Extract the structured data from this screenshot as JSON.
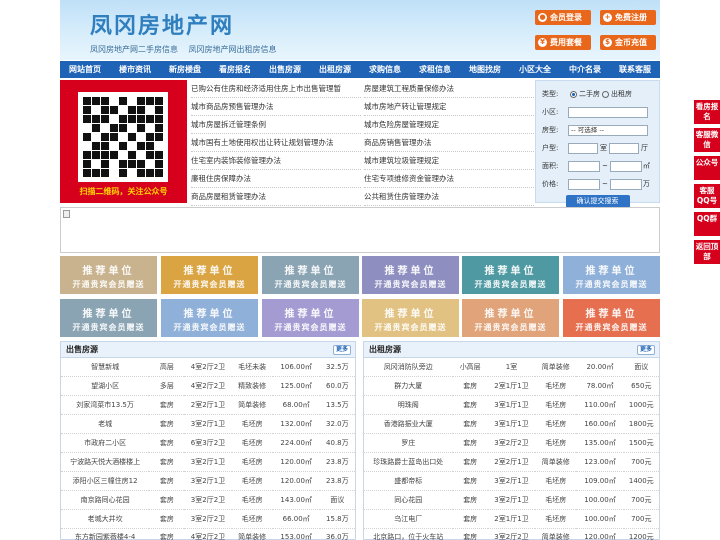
{
  "header": {
    "logo": "凤冈房地产网",
    "slogans": [
      "凤冈房地产网二手房信息",
      "凤冈房地产网出租房信息"
    ],
    "buttons": [
      "会员登录",
      "免费注册",
      "费用套餐",
      "金币充值"
    ]
  },
  "nav": [
    "网站首页",
    "楼市资讯",
    "新房楼盘",
    "看房报名",
    "出售房源",
    "出租房源",
    "求购信息",
    "求租信息",
    "地图找房",
    "小区大全",
    "中介名录",
    "联系客服"
  ],
  "qr": {
    "caption": "扫描二维码，关注公众号"
  },
  "links_left": [
    "已购公有住房和经济适用住房上市出售管理暂",
    "城市商品房预售管理办法",
    "城市房屋拆迁管理条例",
    "城市国有土地使用权出让转让规划管理办法",
    "住宅室内装饰装修管理办法",
    "廉租住房保障办法",
    "商品房屋租赁管理办法"
  ],
  "links_right": [
    "房屋建筑工程质量保修办法",
    "城市房地产转让管理规定",
    "城市危险房屋管理规定",
    "商品房销售管理办法",
    "城市建筑垃圾管理规定",
    "住宅专项维修资金管理办法",
    "公共租赁住房管理办法"
  ],
  "search": {
    "type_label": "类型:",
    "type_opt1": "二手房",
    "type_opt2": "出租房",
    "area_label": "小区:",
    "house_label": "房型:",
    "house_select": "-- 可选择 --",
    "layout_label": "户型:",
    "room_unit": "室",
    "hall_unit": "厅",
    "size_label": "面积:",
    "size_unit": "㎡",
    "price_label": "价格:",
    "price_unit": "万",
    "button": "确认提交搜索"
  },
  "ads": {
    "line1": "推荐单位",
    "line2": "开通贵宾会员赠送",
    "colors": [
      "#c9b38e",
      "#d9a441",
      "#8aa4b3",
      "#8e8fc0",
      "#4f9aa2",
      "#8fb0d8",
      "#8aa4b3",
      "#8fb0d8",
      "#a59bd3",
      "#e2c282",
      "#e0a37a",
      "#e66f4f"
    ]
  },
  "sale": {
    "title": "出售房源",
    "more": "更多",
    "rows": [
      [
        "智慧新城",
        "高层",
        "4室2厅2卫",
        "毛坯未装",
        "106.00㎡",
        "32.5万"
      ],
      [
        "望湖小区",
        "多层",
        "4室2厅2卫",
        "精致装修",
        "125.00㎡",
        "60.0万"
      ],
      [
        "刘家湾菜市13.5万",
        "套房",
        "2室2厅1卫",
        "简单装修",
        "68.00㎡",
        "13.5万"
      ],
      [
        "老城",
        "套房",
        "3室2厅1卫",
        "毛坯房",
        "132.00㎡",
        "32.0万"
      ],
      [
        "市政府二小区",
        "套房",
        "6室3厅2卫",
        "毛坯房",
        "224.00㎡",
        "40.8万"
      ],
      [
        "宁波路天悦大酒楼楼上",
        "套房",
        "3室2厅1卫",
        "毛坯房",
        "120.00㎡",
        "23.8万"
      ],
      [
        "添阳小区三幢住房12",
        "套房",
        "3室2厅1卫",
        "毛坯房",
        "120.00㎡",
        "23.8万"
      ],
      [
        "南京路同心花园",
        "套房",
        "3室2厅2卫",
        "毛坯房",
        "143.00㎡",
        "面议"
      ],
      [
        "老城大井坎",
        "套房",
        "3室2厅2卫",
        "毛坯房",
        "66.00㎡",
        "15.8万"
      ],
      [
        "东方新园紫薇楼4-4",
        "套房",
        "4室2厅2卫",
        "简单装修",
        "153.00㎡",
        "36.0万"
      ]
    ]
  },
  "rent": {
    "title": "出租房源",
    "more": "更多",
    "rows": [
      [
        "凤冈消防队旁边",
        "小高层",
        "1室",
        "简单装修",
        "20.00㎡",
        "面议"
      ],
      [
        "群力大厦",
        "套房",
        "2室1厅1卫",
        "毛坯房",
        "78.00㎡",
        "650元"
      ],
      [
        "明珠阁",
        "套房",
        "3室1厅1卫",
        "毛坯房",
        "110.00㎡",
        "1000元"
      ],
      [
        "香港路振业大厦",
        "套房",
        "3室1厅1卫",
        "毛坯房",
        "160.00㎡",
        "1800元"
      ],
      [
        "罗庄",
        "套房",
        "3室2厅2卫",
        "毛坯房",
        "135.00㎡",
        "1500元"
      ],
      [
        "珍珠路爵士蓝岛出口处",
        "套房",
        "2室2厅1卫",
        "简单装修",
        "123.00㎡",
        "700元"
      ],
      [
        "盛都帝标",
        "套房",
        "3室2厅1卫",
        "毛坯房",
        "109.00㎡",
        "1400元"
      ],
      [
        "同心花园",
        "套房",
        "3室2厅1卫",
        "毛坯房",
        "100.00㎡",
        "700元"
      ],
      [
        "乌江电厂",
        "套房",
        "2室1厅1卫",
        "毛坯房",
        "100.00㎡",
        "700元"
      ],
      [
        "北京路口，位于火车站",
        "套房",
        "3室2厅2卫",
        "简单装修",
        "120.00㎡",
        "1200元"
      ]
    ]
  },
  "floatbar": [
    "看房报名",
    "客服微信",
    "公众号",
    "客服QQ号",
    "QQ群",
    "返回顶部"
  ]
}
